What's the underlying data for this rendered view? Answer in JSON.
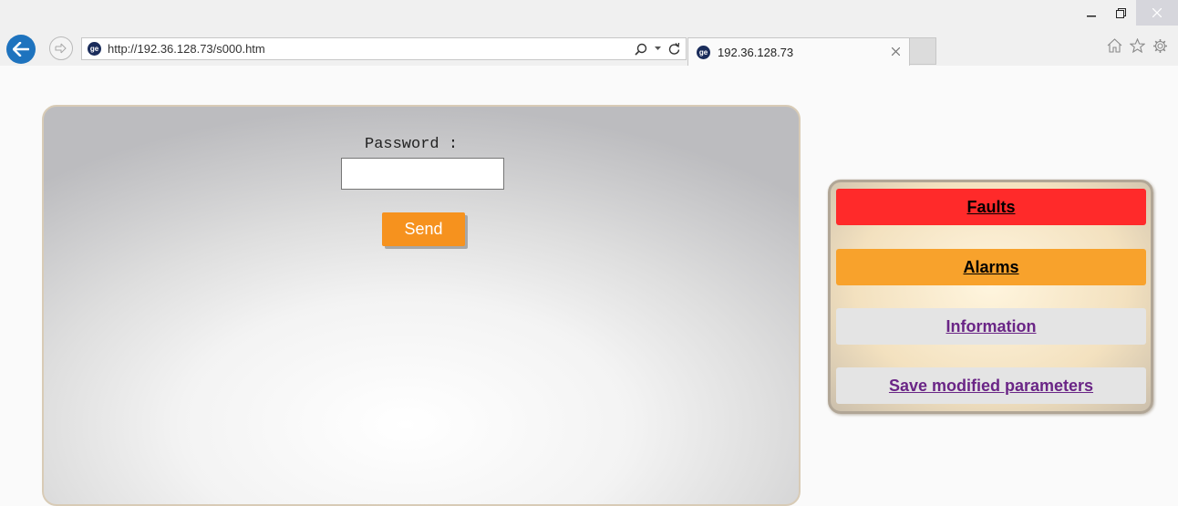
{
  "browser": {
    "url": "http://192.36.128.73/s000.htm",
    "tab_title": "192.36.128.73",
    "site_icon": "ge-logo-icon",
    "window_controls": [
      "minimize-icon",
      "restore-icon",
      "close-icon"
    ],
    "toolbar_icons": [
      "home-icon",
      "star-icon",
      "gear-icon"
    ]
  },
  "login": {
    "password_label": "Password :",
    "password_value": "",
    "send_label": "Send"
  },
  "menu": {
    "faults": "Faults",
    "alarms": "Alarms",
    "information": "Information",
    "save": "Save modified parameters"
  },
  "colors": {
    "faults": "#ff2a2a",
    "alarms": "#f8a22c",
    "send": "#f6921e",
    "link": "#6a2586",
    "back_button": "#1e73be"
  }
}
